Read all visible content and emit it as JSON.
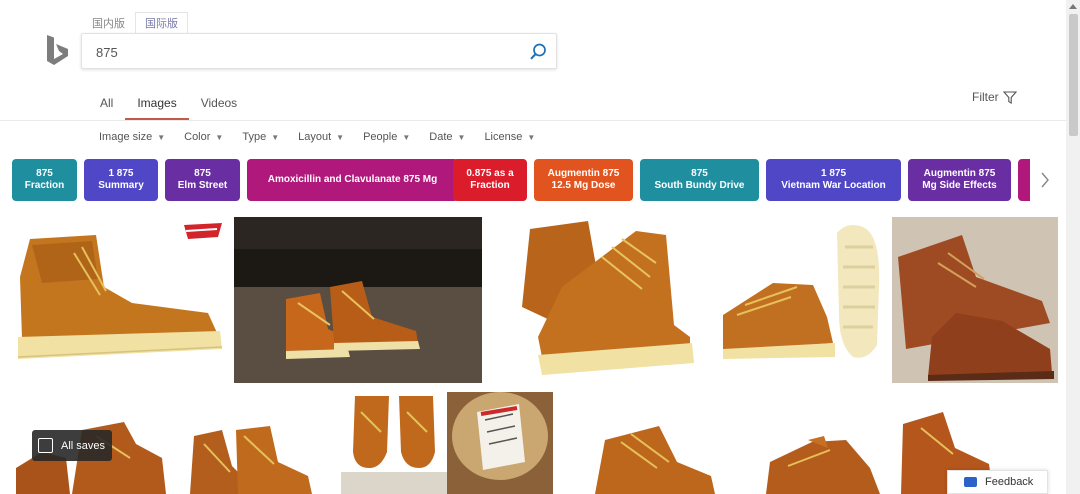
{
  "header": {
    "lang_tabs": [
      "国内版",
      "国际版"
    ],
    "search_value": "875"
  },
  "nav": {
    "items": [
      "All",
      "Images",
      "Videos"
    ],
    "active": "Images",
    "filter_label": "Filter"
  },
  "filterbar": {
    "items": [
      "Image size",
      "Color",
      "Type",
      "Layout",
      "People",
      "Date",
      "License"
    ]
  },
  "chips": [
    {
      "label": "875\nFraction",
      "color": "#1f8fa0"
    },
    {
      "label": "1 875\nSummary",
      "color": "#4f47c6"
    },
    {
      "label": "875\nElm Street",
      "color": "#6a2ea3"
    },
    {
      "label": "Amoxicillin and Clavulanate 875 Mg",
      "color": "#b0187b"
    },
    {
      "label": "0.875 as a\nFraction",
      "color": "#db1c2a"
    },
    {
      "label": "Augmentin 875\n12.5 Mg Dose",
      "color": "#e2541f"
    },
    {
      "label": "875\nSouth Bundy Drive",
      "color": "#1f8fa0"
    },
    {
      "label": "1 875\nVietnam War Location",
      "color": "#4f47c6"
    },
    {
      "label": "Augmentin 875\nMg Side Effects",
      "color": "#6a2ea3"
    },
    {
      "label": "",
      "color": "#b0187b"
    }
  ],
  "results": {
    "row1_count": 5,
    "row2_count": 7
  },
  "overlay": {
    "all_saves": "All saves",
    "feedback": "Feedback"
  }
}
